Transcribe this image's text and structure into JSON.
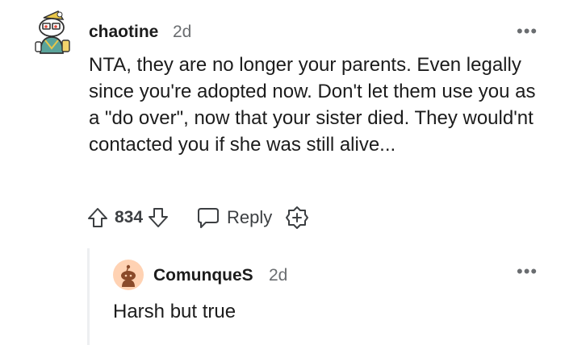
{
  "comment": {
    "author": "chaotine",
    "age": "2d",
    "body": "NTA, they are no longer your parents. Even legally since you're adopted now. Don't let them use you as a \"do over\", now that your sister died. They would'nt contacted you if she was still alive...",
    "score": "834",
    "reply_label": "Reply",
    "more_label": "•••",
    "icons": {
      "upvote": "upvote-icon",
      "downvote": "downvote-icon",
      "reply": "speech-bubble-icon",
      "award": "award-plus-icon"
    }
  },
  "reply": {
    "author": "ComunqueS",
    "age": "2d",
    "body": "Harsh but true",
    "more_label": "•••"
  },
  "colors": {
    "text": "#1c1c1c",
    "meta": "#6a6d70",
    "icon": "#3c3f42",
    "thread_line": "#edeff1",
    "reply_avatar_bg": "#ffd2b3"
  }
}
